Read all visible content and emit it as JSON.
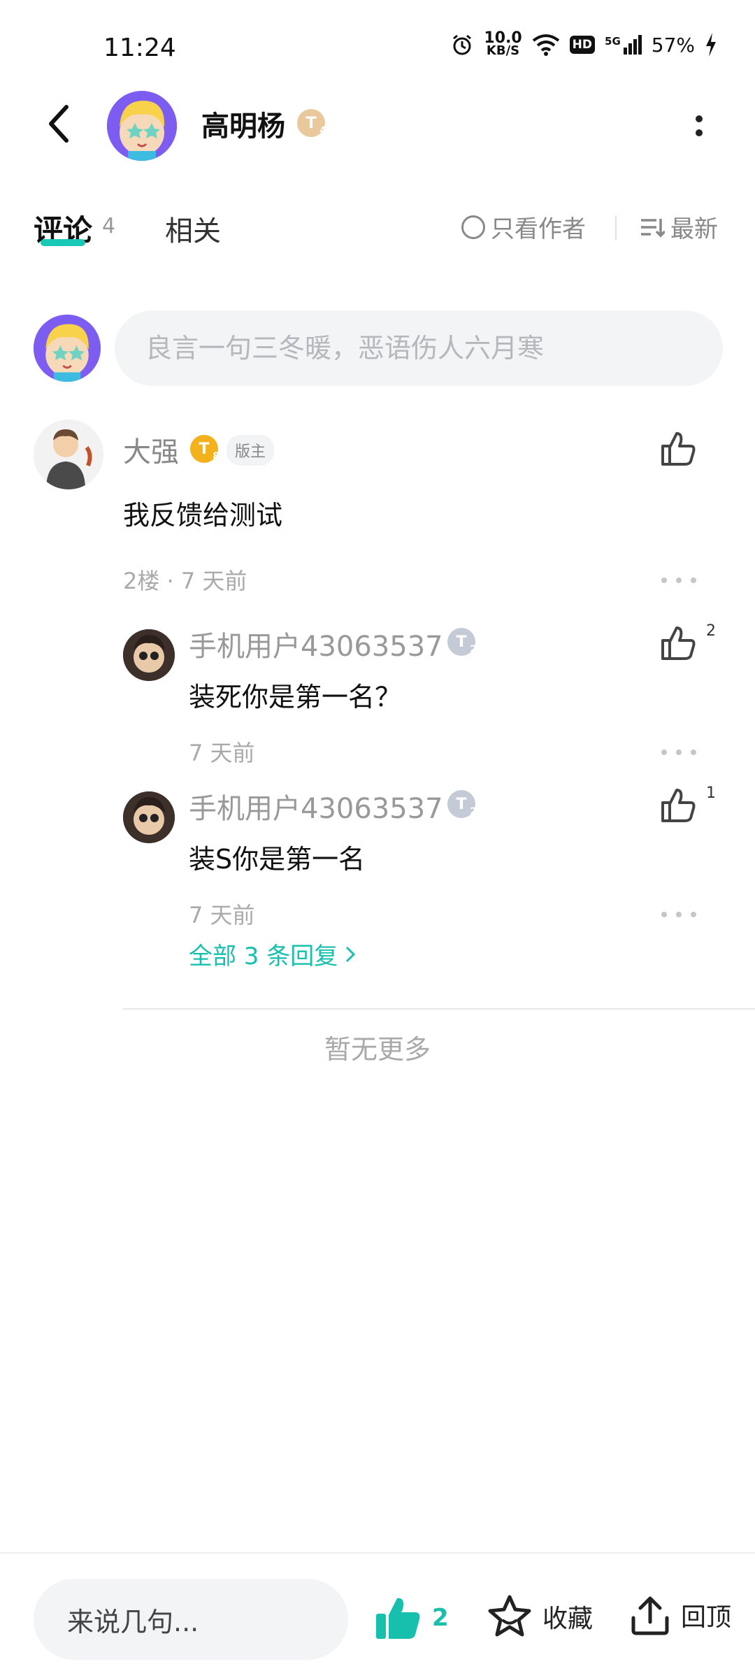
{
  "status_bar": {
    "time": "11:24",
    "net_speed_value": "10.0",
    "net_speed_unit": "KB/S",
    "hd": "HD",
    "network": "5G",
    "battery": "57%"
  },
  "header": {
    "title": "高明杨",
    "level": "T",
    "level_sub": "4"
  },
  "tabs": {
    "comments_label": "评论",
    "comments_count": "4",
    "related_label": "相关",
    "author_only_label": "只看作者",
    "sort_label": "最新"
  },
  "comment_input": {
    "placeholder": "良言一句三冬暖，恶语伤人六月寒"
  },
  "comment": {
    "author": "大强",
    "level": "T",
    "level_sub": "8",
    "moderator_badge": "版主",
    "text": "我反馈给测试",
    "meta": "2楼 · 7 天前",
    "replies": [
      {
        "author": "手机用户43063537",
        "level": "T",
        "level_sub": "2",
        "text": "装死你是第一名？",
        "meta": "7 天前",
        "likes": "2"
      },
      {
        "author": "手机用户43063537",
        "level": "T",
        "level_sub": "2",
        "text": "装S你是第一名",
        "meta": "7 天前",
        "likes": "1"
      }
    ],
    "all_replies_label": "全部 3 条回复"
  },
  "footer": {
    "no_more": "暂无更多"
  },
  "bottom_bar": {
    "input_placeholder": "来说几句...",
    "like_count": "2",
    "favorite_label": "收藏",
    "back_top_label": "回顶"
  },
  "colors": {
    "accent": "#16c0ad",
    "gold": "#f3b21c",
    "silver": "#c5cbd6"
  }
}
